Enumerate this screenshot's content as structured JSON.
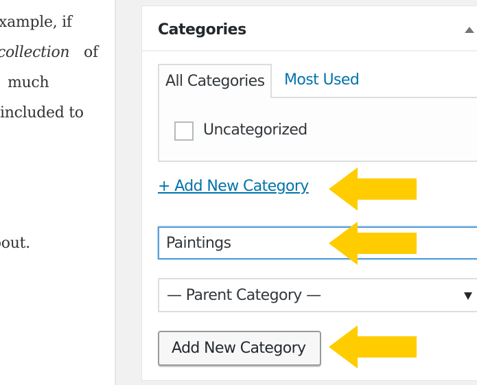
{
  "article": {
    "lines": [
      "xample, if",
      "collection",
      "of",
      "much",
      "included to",
      "bout."
    ]
  },
  "panel": {
    "title": "Categories",
    "tabs": [
      {
        "label": "All Categories",
        "active": true
      },
      {
        "label": "Most Used",
        "active": false
      }
    ],
    "categories": [
      {
        "label": "Uncategorized",
        "checked": false
      }
    ],
    "add_link": "+ Add New Category",
    "new_category_value": "Paintings",
    "parent_select": "— Parent Category —",
    "submit_label": "Add New Category"
  },
  "annotations": {
    "arrow_color": "#ffcc00",
    "arrow_icon": "arrow-left-icon"
  },
  "colors": {
    "link": "#0073aa",
    "focus_border": "#5b9dd9"
  }
}
